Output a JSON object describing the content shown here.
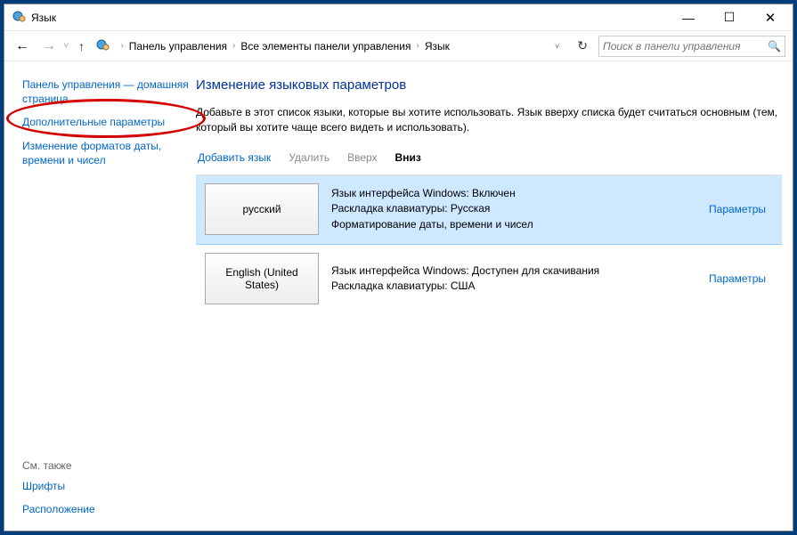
{
  "window": {
    "title": "Язык"
  },
  "breadcrumb": {
    "crumb1": "Панель управления",
    "crumb2": "Все элементы панели управления",
    "crumb3": "Язык"
  },
  "search": {
    "placeholder": "Поиск в панели управления"
  },
  "sidebar": {
    "link_home": "Панель управления — домашняя страница",
    "link_advanced": "Дополнительные параметры",
    "link_formats": "Изменение форматов даты, времени и чисел",
    "see_also": "См. также",
    "link_fonts": "Шрифты",
    "link_location": "Расположение"
  },
  "main": {
    "title": "Изменение языковых параметров",
    "desc": "Добавьте в этот список языки, которые вы хотите использовать. Язык вверху списка будет считаться основным (тем, который вы хотите чаще всего видеть и использовать)."
  },
  "toolbar": {
    "add": "Добавить язык",
    "remove": "Удалить",
    "up": "Вверх",
    "down": "Вниз"
  },
  "langs": [
    {
      "tile": "русский",
      "line1": "Язык интерфейса Windows: Включен",
      "line2": "Раскладка клавиатуры: Русская",
      "line3": "Форматирование даты, времени и чисел",
      "opts": "Параметры",
      "selected": true
    },
    {
      "tile": "English (United States)",
      "line1": "Язык интерфейса Windows: Доступен для скачивания",
      "line2": "Раскладка клавиатуры: США",
      "line3": "",
      "opts": "Параметры",
      "selected": false
    }
  ]
}
